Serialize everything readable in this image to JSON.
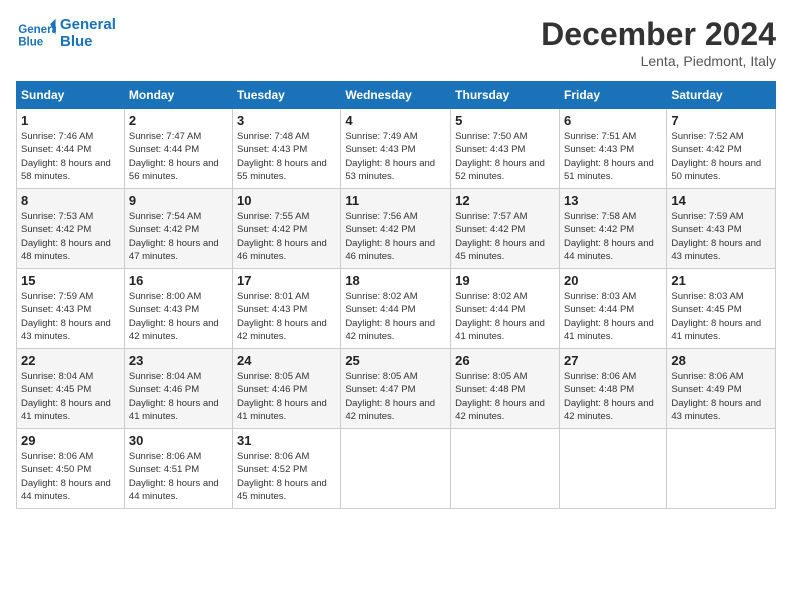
{
  "header": {
    "title": "December 2024",
    "location": "Lenta, Piedmont, Italy",
    "logo_line1": "General",
    "logo_line2": "Blue"
  },
  "weekdays": [
    "Sunday",
    "Monday",
    "Tuesday",
    "Wednesday",
    "Thursday",
    "Friday",
    "Saturday"
  ],
  "weeks": [
    [
      {
        "day": "1",
        "sunrise": "Sunrise: 7:46 AM",
        "sunset": "Sunset: 4:44 PM",
        "daylight": "Daylight: 8 hours and 58 minutes."
      },
      {
        "day": "2",
        "sunrise": "Sunrise: 7:47 AM",
        "sunset": "Sunset: 4:44 PM",
        "daylight": "Daylight: 8 hours and 56 minutes."
      },
      {
        "day": "3",
        "sunrise": "Sunrise: 7:48 AM",
        "sunset": "Sunset: 4:43 PM",
        "daylight": "Daylight: 8 hours and 55 minutes."
      },
      {
        "day": "4",
        "sunrise": "Sunrise: 7:49 AM",
        "sunset": "Sunset: 4:43 PM",
        "daylight": "Daylight: 8 hours and 53 minutes."
      },
      {
        "day": "5",
        "sunrise": "Sunrise: 7:50 AM",
        "sunset": "Sunset: 4:43 PM",
        "daylight": "Daylight: 8 hours and 52 minutes."
      },
      {
        "day": "6",
        "sunrise": "Sunrise: 7:51 AM",
        "sunset": "Sunset: 4:43 PM",
        "daylight": "Daylight: 8 hours and 51 minutes."
      },
      {
        "day": "7",
        "sunrise": "Sunrise: 7:52 AM",
        "sunset": "Sunset: 4:42 PM",
        "daylight": "Daylight: 8 hours and 50 minutes."
      }
    ],
    [
      {
        "day": "8",
        "sunrise": "Sunrise: 7:53 AM",
        "sunset": "Sunset: 4:42 PM",
        "daylight": "Daylight: 8 hours and 48 minutes."
      },
      {
        "day": "9",
        "sunrise": "Sunrise: 7:54 AM",
        "sunset": "Sunset: 4:42 PM",
        "daylight": "Daylight: 8 hours and 47 minutes."
      },
      {
        "day": "10",
        "sunrise": "Sunrise: 7:55 AM",
        "sunset": "Sunset: 4:42 PM",
        "daylight": "Daylight: 8 hours and 46 minutes."
      },
      {
        "day": "11",
        "sunrise": "Sunrise: 7:56 AM",
        "sunset": "Sunset: 4:42 PM",
        "daylight": "Daylight: 8 hours and 46 minutes."
      },
      {
        "day": "12",
        "sunrise": "Sunrise: 7:57 AM",
        "sunset": "Sunset: 4:42 PM",
        "daylight": "Daylight: 8 hours and 45 minutes."
      },
      {
        "day": "13",
        "sunrise": "Sunrise: 7:58 AM",
        "sunset": "Sunset: 4:42 PM",
        "daylight": "Daylight: 8 hours and 44 minutes."
      },
      {
        "day": "14",
        "sunrise": "Sunrise: 7:59 AM",
        "sunset": "Sunset: 4:43 PM",
        "daylight": "Daylight: 8 hours and 43 minutes."
      }
    ],
    [
      {
        "day": "15",
        "sunrise": "Sunrise: 7:59 AM",
        "sunset": "Sunset: 4:43 PM",
        "daylight": "Daylight: 8 hours and 43 minutes."
      },
      {
        "day": "16",
        "sunrise": "Sunrise: 8:00 AM",
        "sunset": "Sunset: 4:43 PM",
        "daylight": "Daylight: 8 hours and 42 minutes."
      },
      {
        "day": "17",
        "sunrise": "Sunrise: 8:01 AM",
        "sunset": "Sunset: 4:43 PM",
        "daylight": "Daylight: 8 hours and 42 minutes."
      },
      {
        "day": "18",
        "sunrise": "Sunrise: 8:02 AM",
        "sunset": "Sunset: 4:44 PM",
        "daylight": "Daylight: 8 hours and 42 minutes."
      },
      {
        "day": "19",
        "sunrise": "Sunrise: 8:02 AM",
        "sunset": "Sunset: 4:44 PM",
        "daylight": "Daylight: 8 hours and 41 minutes."
      },
      {
        "day": "20",
        "sunrise": "Sunrise: 8:03 AM",
        "sunset": "Sunset: 4:44 PM",
        "daylight": "Daylight: 8 hours and 41 minutes."
      },
      {
        "day": "21",
        "sunrise": "Sunrise: 8:03 AM",
        "sunset": "Sunset: 4:45 PM",
        "daylight": "Daylight: 8 hours and 41 minutes."
      }
    ],
    [
      {
        "day": "22",
        "sunrise": "Sunrise: 8:04 AM",
        "sunset": "Sunset: 4:45 PM",
        "daylight": "Daylight: 8 hours and 41 minutes."
      },
      {
        "day": "23",
        "sunrise": "Sunrise: 8:04 AM",
        "sunset": "Sunset: 4:46 PM",
        "daylight": "Daylight: 8 hours and 41 minutes."
      },
      {
        "day": "24",
        "sunrise": "Sunrise: 8:05 AM",
        "sunset": "Sunset: 4:46 PM",
        "daylight": "Daylight: 8 hours and 41 minutes."
      },
      {
        "day": "25",
        "sunrise": "Sunrise: 8:05 AM",
        "sunset": "Sunset: 4:47 PM",
        "daylight": "Daylight: 8 hours and 42 minutes."
      },
      {
        "day": "26",
        "sunrise": "Sunrise: 8:05 AM",
        "sunset": "Sunset: 4:48 PM",
        "daylight": "Daylight: 8 hours and 42 minutes."
      },
      {
        "day": "27",
        "sunrise": "Sunrise: 8:06 AM",
        "sunset": "Sunset: 4:48 PM",
        "daylight": "Daylight: 8 hours and 42 minutes."
      },
      {
        "day": "28",
        "sunrise": "Sunrise: 8:06 AM",
        "sunset": "Sunset: 4:49 PM",
        "daylight": "Daylight: 8 hours and 43 minutes."
      }
    ],
    [
      {
        "day": "29",
        "sunrise": "Sunrise: 8:06 AM",
        "sunset": "Sunset: 4:50 PM",
        "daylight": "Daylight: 8 hours and 44 minutes."
      },
      {
        "day": "30",
        "sunrise": "Sunrise: 8:06 AM",
        "sunset": "Sunset: 4:51 PM",
        "daylight": "Daylight: 8 hours and 44 minutes."
      },
      {
        "day": "31",
        "sunrise": "Sunrise: 8:06 AM",
        "sunset": "Sunset: 4:52 PM",
        "daylight": "Daylight: 8 hours and 45 minutes."
      },
      null,
      null,
      null,
      null
    ]
  ]
}
